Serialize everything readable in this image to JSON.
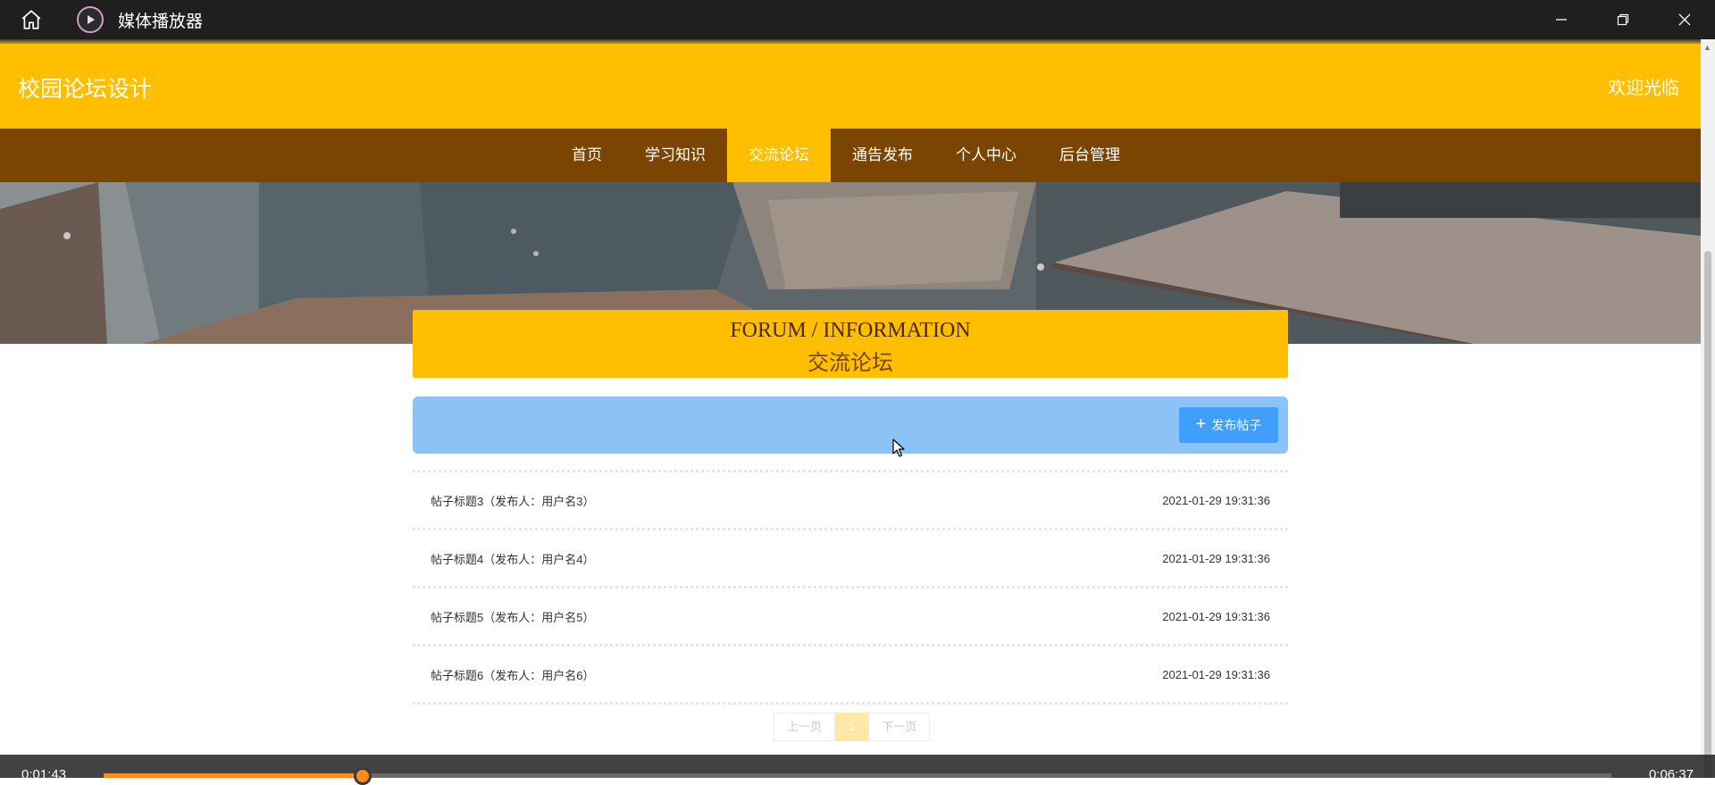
{
  "window": {
    "title": "媒体播放器",
    "controls": {
      "minimize": "minimize-icon",
      "restore": "restore-icon",
      "close": "close-icon"
    }
  },
  "site": {
    "title": "校园论坛设计",
    "welcome": "欢迎光临"
  },
  "nav": {
    "items": [
      {
        "label": "首页"
      },
      {
        "label": "学习知识"
      },
      {
        "label": "交流论坛"
      },
      {
        "label": "通告发布"
      },
      {
        "label": "个人中心"
      },
      {
        "label": "后台管理"
      }
    ],
    "active_index": 2
  },
  "banner": {
    "slides": 3,
    "active_slide": 1
  },
  "section": {
    "title_en": "FORUM / INFORMATION",
    "title_cn": "交流论坛"
  },
  "actions": {
    "post_label": "发布帖子"
  },
  "posts": [
    {
      "title": "帖子标题3（发布人：用户名3）",
      "time": "2021-01-29 19:31:36"
    },
    {
      "title": "帖子标题4（发布人：用户名4）",
      "time": "2021-01-29 19:31:36"
    },
    {
      "title": "帖子标题5（发布人：用户名5）",
      "time": "2021-01-29 19:31:36"
    },
    {
      "title": "帖子标题6（发布人：用户名6）",
      "time": "2021-01-29 19:31:36"
    }
  ],
  "pagination": {
    "prev": "上一页",
    "current": "1",
    "next": "下一页"
  },
  "player": {
    "current_time": "0:01:43",
    "total_time": "0:06:37",
    "progress_fraction": 0.172
  },
  "colors": {
    "header": "#ffbf00",
    "nav": "#7a4500",
    "action_bar": "#8cc3f7",
    "button": "#409eff",
    "progress": "#ff8c1a"
  }
}
